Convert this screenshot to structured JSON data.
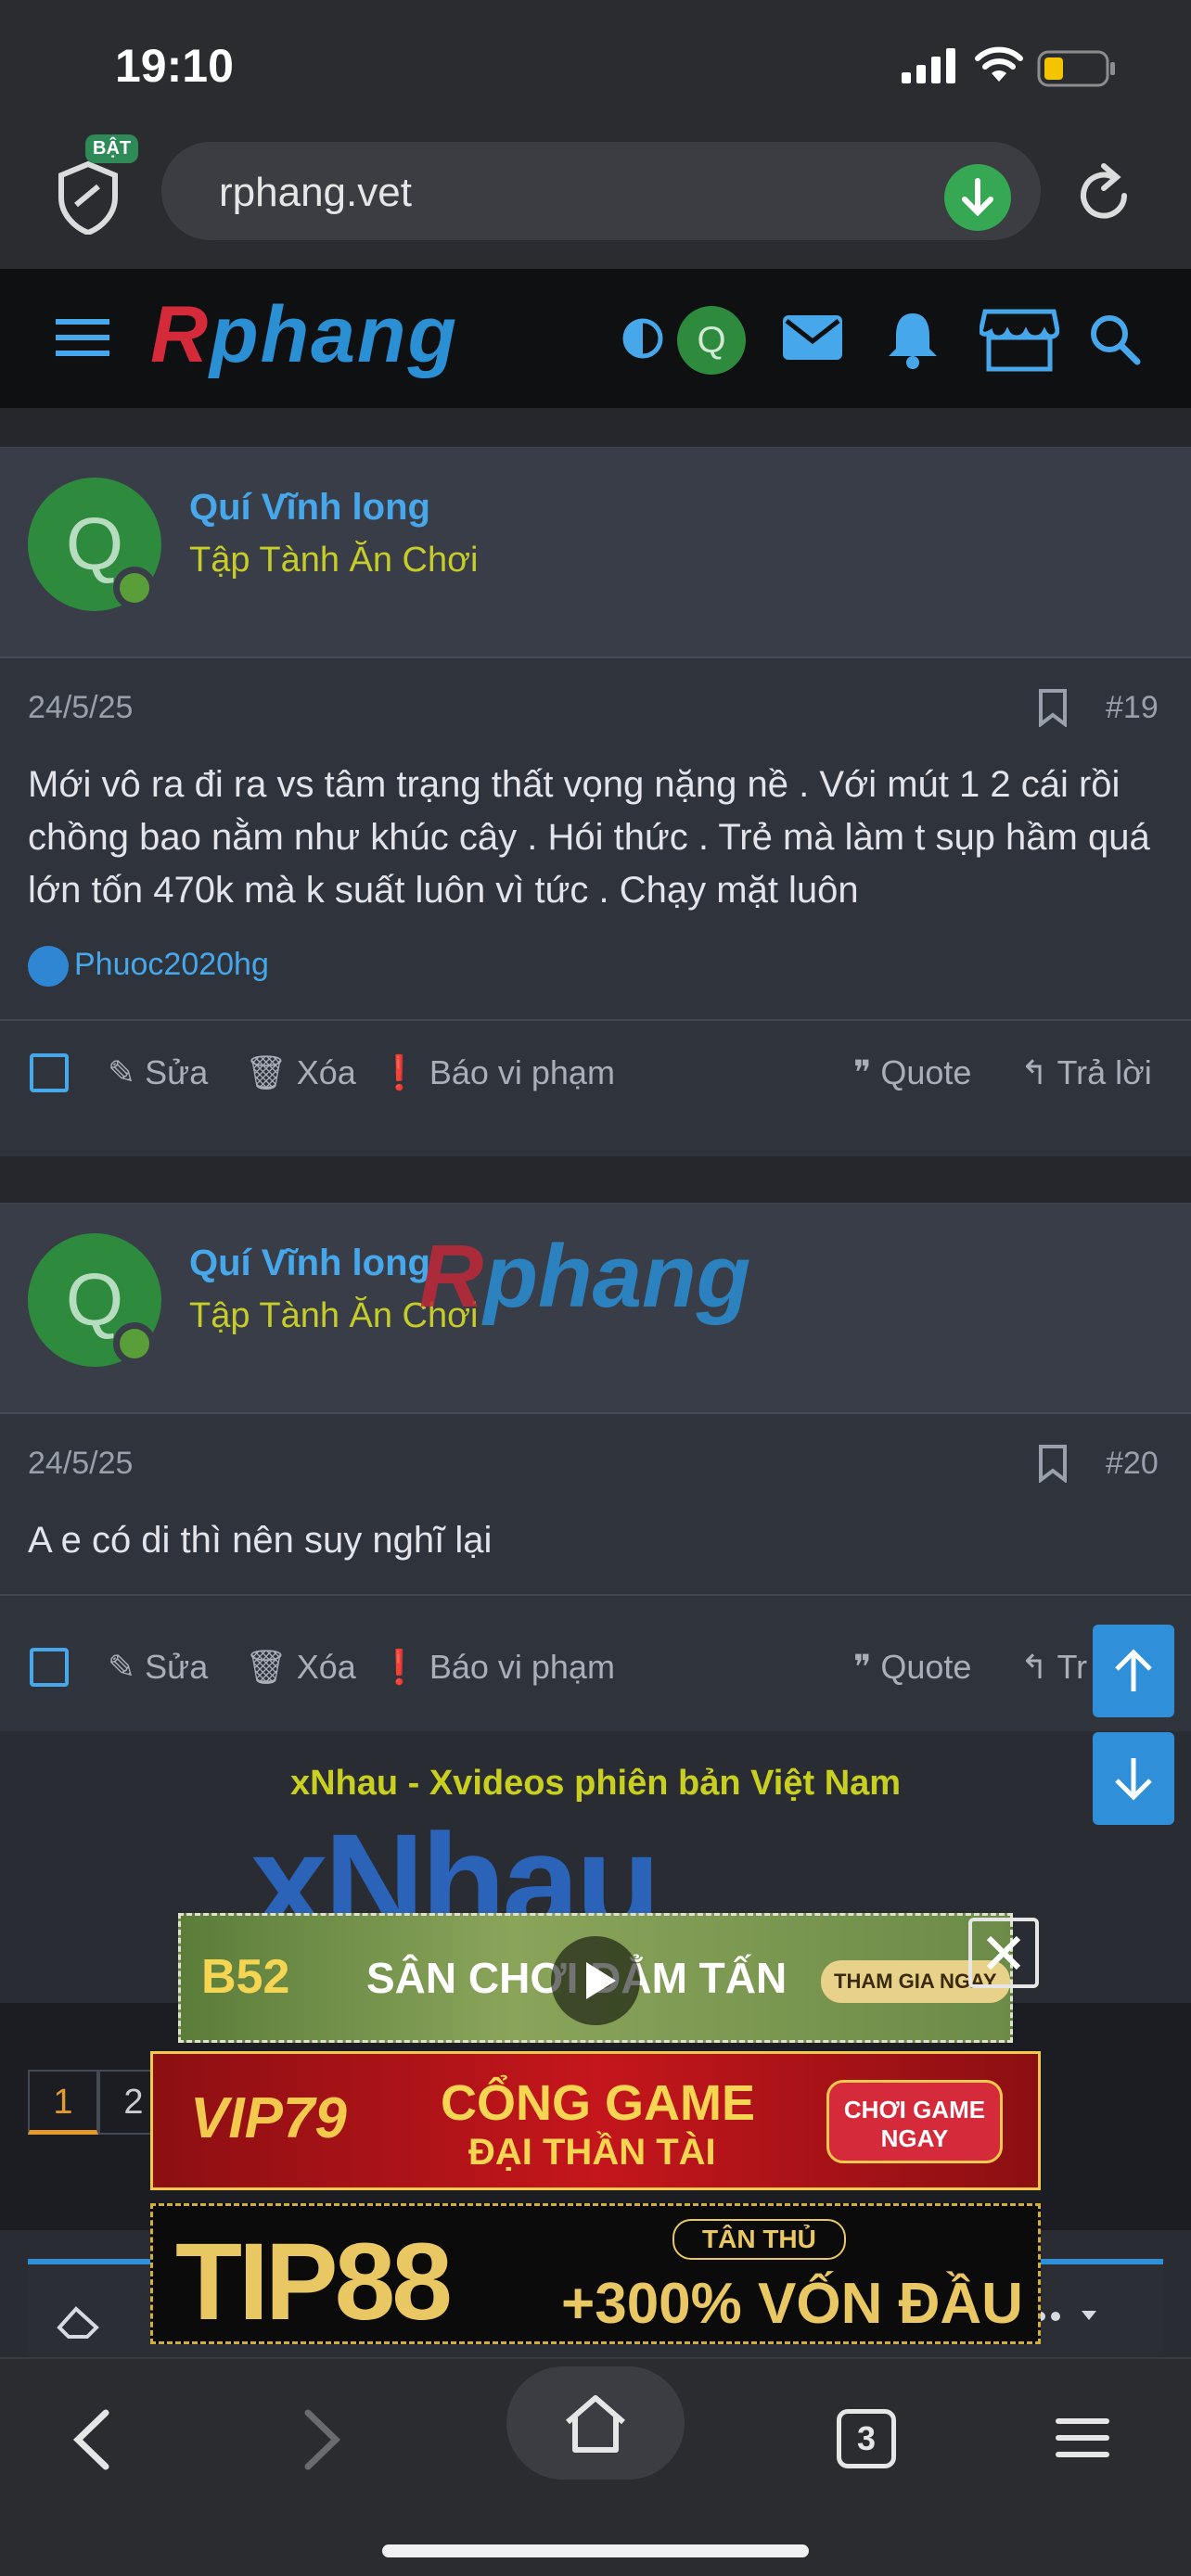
{
  "status_bar": {
    "time": "19:10"
  },
  "browser": {
    "shield_badge": "BẬT",
    "url": "rphang.vet",
    "tab_count": "3"
  },
  "site": {
    "logo_r": "R",
    "logo_rest": "phang",
    "avatar_initial": "Q"
  },
  "posts": [
    {
      "author": "Quí Vĩnh long",
      "user_title": "Tập Tành Ăn Chơi",
      "avatar_initial": "Q",
      "date": "24/5/25",
      "number": "#19",
      "body": "Mới vô ra đi ra vs tâm trạng thất vọng nặng nề . Với mút 1 2 cái rồi chồng bao nằm như khúc cây . Hói thức . Trẻ mà làm t sụp hầm quá lớn tốn 470k mà k suất luôn vì tức . Chạy mặt luôn",
      "reaction_user": "Phuoc2020hg"
    },
    {
      "author": "Quí Vĩnh long",
      "user_title": "Tập Tành Ăn Chơi",
      "avatar_initial": "Q",
      "date": "24/5/25",
      "number": "#20",
      "body": "A e có di thì nên suy nghĩ lại"
    }
  ],
  "actions": {
    "edit": "Sửa",
    "delete": "Xóa",
    "report": "Báo vi phạm",
    "quote": "Quote",
    "reply": "Trả lời",
    "reply_cut": "Tr"
  },
  "watermark": {
    "r": "R",
    "rest": "phang"
  },
  "ads": {
    "title": "xNhau - Xvideos phiên bản Việt Nam",
    "xnhau_logo": "xNhau",
    "banner1_logo": "B52",
    "banner1_text": "SÂN CHƠI ĐẲM TẤN",
    "banner1_cta": "THAM GIA NGAY",
    "banner2_logo": "VIP79",
    "banner2_line1": "CỔNG GAME",
    "banner2_line2": "ĐẠI THẦN TÀI",
    "banner2_cta_1": "CHƠI GAME",
    "banner2_cta_2": "NGAY",
    "banner3_logo": "TIP88",
    "banner3_tag": "TÂN THỦ",
    "banner3_offer": "+300% VỐN ĐẦU"
  },
  "pagination": {
    "pages": [
      "1",
      "2"
    ],
    "current": "1"
  },
  "colors": {
    "accent": "#47a7eb",
    "user_title": "#c6cd28",
    "online": "#5a9e3a"
  }
}
